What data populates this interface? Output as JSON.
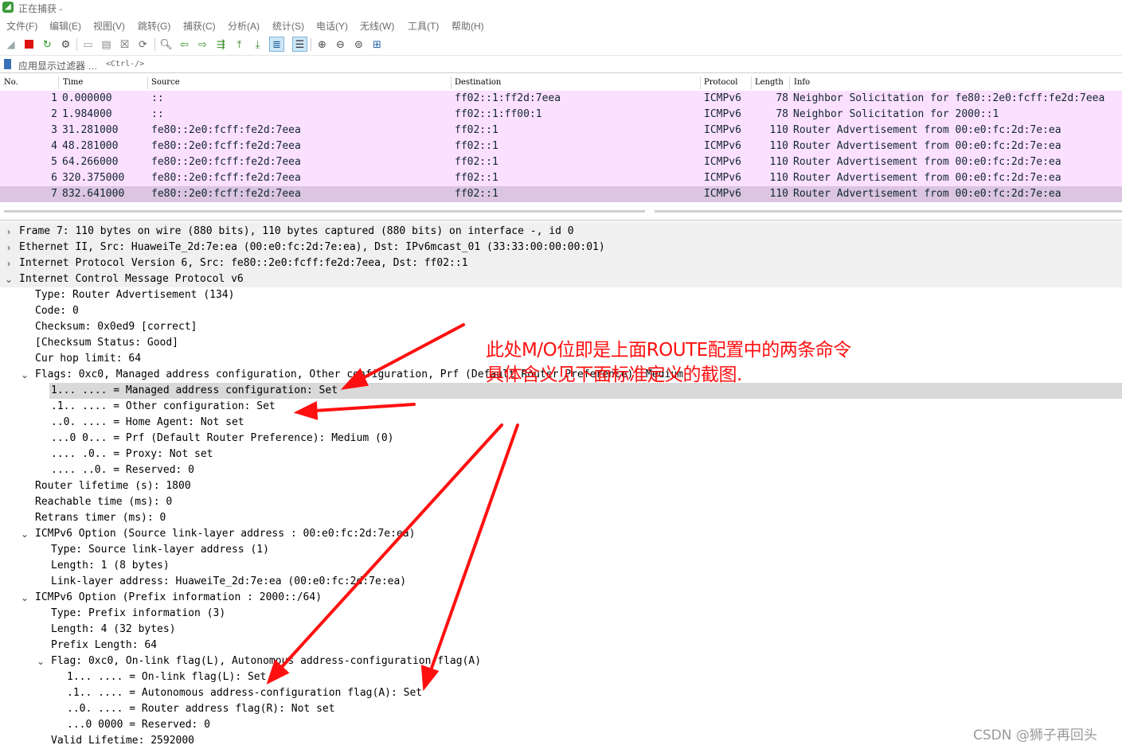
{
  "window": {
    "title": "正在捕获 -"
  },
  "menu": [
    "文件(F)",
    "编辑(E)",
    "视图(V)",
    "跳转(G)",
    "捕获(C)",
    "分析(A)",
    "统计(S)",
    "电话(Y)",
    "无线(W)",
    "工具(T)",
    "帮助(H)"
  ],
  "filter": {
    "placeholder": "应用显示过滤器 …",
    "shortcut": "<Ctrl-/>"
  },
  "columns": {
    "no": "No.",
    "time": "Time",
    "source": "Source",
    "destination": "Destination",
    "protocol": "Protocol",
    "length": "Length",
    "info": "Info"
  },
  "packets": [
    {
      "no": "1",
      "time": "0.000000",
      "source": "::",
      "destination": "ff02::1:ff2d:7eea",
      "protocol": "ICMPv6",
      "length": "78",
      "info": "Neighbor Solicitation for fe80::2e0:fcff:fe2d:7eea"
    },
    {
      "no": "2",
      "time": "1.984000",
      "source": "::",
      "destination": "ff02::1:ff00:1",
      "protocol": "ICMPv6",
      "length": "78",
      "info": "Neighbor Solicitation for 2000::1"
    },
    {
      "no": "3",
      "time": "31.281000",
      "source": "fe80::2e0:fcff:fe2d:7eea",
      "destination": "ff02::1",
      "protocol": "ICMPv6",
      "length": "110",
      "info": "Router Advertisement from 00:e0:fc:2d:7e:ea"
    },
    {
      "no": "4",
      "time": "48.281000",
      "source": "fe80::2e0:fcff:fe2d:7eea",
      "destination": "ff02::1",
      "protocol": "ICMPv6",
      "length": "110",
      "info": "Router Advertisement from 00:e0:fc:2d:7e:ea"
    },
    {
      "no": "5",
      "time": "64.266000",
      "source": "fe80::2e0:fcff:fe2d:7eea",
      "destination": "ff02::1",
      "protocol": "ICMPv6",
      "length": "110",
      "info": "Router Advertisement from 00:e0:fc:2d:7e:ea"
    },
    {
      "no": "6",
      "time": "320.375000",
      "source": "fe80::2e0:fcff:fe2d:7eea",
      "destination": "ff02::1",
      "protocol": "ICMPv6",
      "length": "110",
      "info": "Router Advertisement from 00:e0:fc:2d:7e:ea"
    },
    {
      "no": "7",
      "time": "832.641000",
      "source": "fe80::2e0:fcff:fe2d:7eea",
      "destination": "ff02::1",
      "protocol": "ICMPv6",
      "length": "110",
      "info": "Router Advertisement from 00:e0:fc:2d:7e:ea"
    }
  ],
  "details": [
    {
      "text": "Frame 7: 110 bytes on wire (880 bits), 110 bytes captured (880 bits) on interface -, id 0",
      "toggle": "›"
    },
    {
      "text": "Ethernet II, Src: HuaweiTe_2d:7e:ea (00:e0:fc:2d:7e:ea), Dst: IPv6mcast_01 (33:33:00:00:00:01)",
      "toggle": "›"
    },
    {
      "text": "Internet Protocol Version 6, Src: fe80::2e0:fcff:fe2d:7eea, Dst: ff02::1",
      "toggle": "›"
    },
    {
      "text": "Internet Control Message Protocol v6",
      "toggle": "⌄"
    },
    {
      "text": "Type: Router Advertisement (134)",
      "toggle": ""
    },
    {
      "text": "Code: 0",
      "toggle": ""
    },
    {
      "text": "Checksum: 0x0ed9 [correct]",
      "toggle": ""
    },
    {
      "text": "[Checksum Status: Good]",
      "toggle": ""
    },
    {
      "text": "Cur hop limit: 64",
      "toggle": ""
    },
    {
      "text": "Flags: 0xc0, Managed address configuration, Other configuration, Prf (Default Router Preference): Medium",
      "toggle": "⌄"
    },
    {
      "text": "1... .... = Managed address configuration: Set",
      "toggle": ""
    },
    {
      "text": ".1.. .... = Other configuration: Set",
      "toggle": ""
    },
    {
      "text": "..0. .... = Home Agent: Not set",
      "toggle": ""
    },
    {
      "text": "...0 0... = Prf (Default Router Preference): Medium (0)",
      "toggle": ""
    },
    {
      "text": ".... .0.. = Proxy: Not set",
      "toggle": ""
    },
    {
      "text": ".... ..0. = Reserved: 0",
      "toggle": ""
    },
    {
      "text": "Router lifetime (s): 1800",
      "toggle": ""
    },
    {
      "text": "Reachable time (ms): 0",
      "toggle": ""
    },
    {
      "text": "Retrans timer (ms): 0",
      "toggle": ""
    },
    {
      "text": "ICMPv6 Option (Source link-layer address : 00:e0:fc:2d:7e:ea)",
      "toggle": "⌄"
    },
    {
      "text": "Type: Source link-layer address (1)",
      "toggle": ""
    },
    {
      "text": "Length: 1 (8 bytes)",
      "toggle": ""
    },
    {
      "text": "Link-layer address: HuaweiTe_2d:7e:ea (00:e0:fc:2d:7e:ea)",
      "toggle": ""
    },
    {
      "text": "ICMPv6 Option (Prefix information : 2000::/64)",
      "toggle": "⌄"
    },
    {
      "text": "Type: Prefix information (3)",
      "toggle": ""
    },
    {
      "text": "Length: 4 (32 bytes)",
      "toggle": ""
    },
    {
      "text": "Prefix Length: 64",
      "toggle": ""
    },
    {
      "text": "Flag: 0xc0, On-link flag(L), Autonomous address-configuration flag(A)",
      "toggle": "⌄"
    },
    {
      "text": "1... .... = On-link flag(L): Set",
      "toggle": ""
    },
    {
      "text": ".1.. .... = Autonomous address-configuration flag(A): Set",
      "toggle": ""
    },
    {
      "text": "..0. .... = Router address flag(R): Not set",
      "toggle": ""
    },
    {
      "text": "...0 0000 = Reserved: 0",
      "toggle": ""
    },
    {
      "text": "Valid Lifetime: 2592000",
      "toggle": ""
    }
  ],
  "annotation": {
    "line1": "此处M/O位即是上面ROUTE配置中的两条命令",
    "line2": "具体含义见下面标准定义的截图.",
    "color": "#ff1010"
  },
  "watermark": "CSDN @狮子再回头",
  "colors": {
    "packet_row": "#fce0ff",
    "packet_row_selected": "#dbc5e0",
    "detail_selected": "#d9d9d9"
  }
}
